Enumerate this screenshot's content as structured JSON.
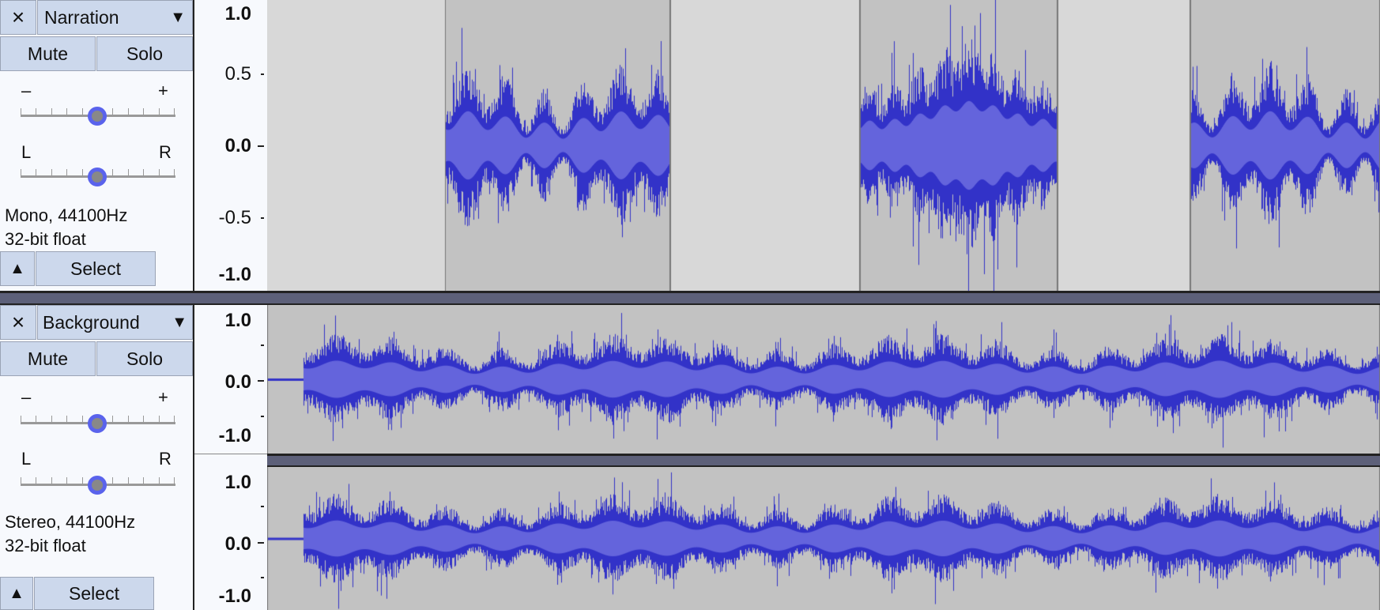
{
  "tracks": [
    {
      "name": "Narration",
      "close_icon": "×",
      "menu_icon": "▼",
      "mute": "Mute",
      "solo": "Solo",
      "gain_min": "–",
      "gain_max": "+",
      "pan_left": "L",
      "pan_right": "R",
      "info_line1": "Mono, 44100Hz",
      "info_line2": "32-bit float",
      "collapse_icon": "▲",
      "select": "Select",
      "gain_value": 0.5,
      "pan_value": 0.5,
      "ruler": [
        "1.0",
        "0.5",
        "0.0",
        "-0.5",
        "-1.0"
      ]
    },
    {
      "name": "Background",
      "close_icon": "×",
      "menu_icon": "▼",
      "mute": "Mute",
      "solo": "Solo",
      "gain_min": "–",
      "gain_max": "+",
      "pan_left": "L",
      "pan_right": "R",
      "info_line1": "Stereo, 44100Hz",
      "info_line2": "32-bit float",
      "collapse_icon": "▲",
      "select": "Select",
      "gain_value": 0.5,
      "pan_value": 0.5,
      "ruler_ch1": [
        "1.0",
        "0.0",
        "-1.0"
      ],
      "ruler_ch2": [
        "1.0",
        "0.0",
        "-1.0"
      ]
    }
  ],
  "colors": {
    "waveform_peak": "#3232c8",
    "waveform_rms": "#6464dc",
    "clip_bg": "#c2c2c2",
    "gap_bg": "#d8d8d8",
    "separator": "#5d6079"
  }
}
